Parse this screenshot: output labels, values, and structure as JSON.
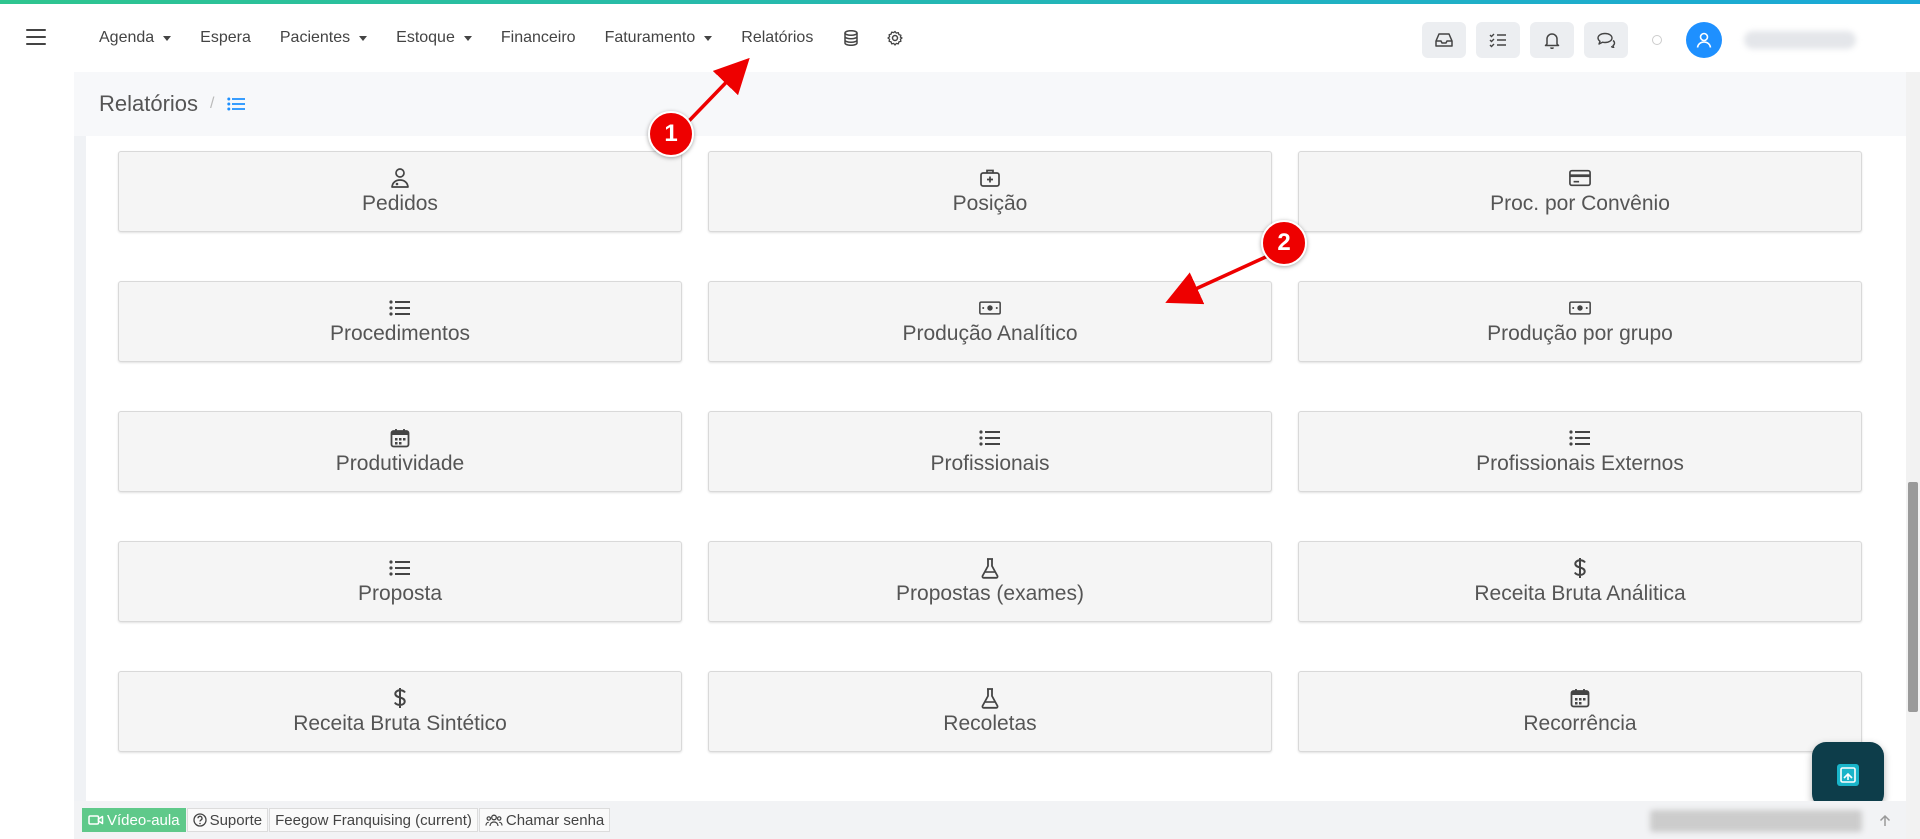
{
  "nav": {
    "items": [
      {
        "label": "Agenda",
        "dropdown": true
      },
      {
        "label": "Espera",
        "dropdown": false
      },
      {
        "label": "Pacientes",
        "dropdown": true
      },
      {
        "label": "Estoque",
        "dropdown": true
      },
      {
        "label": "Financeiro",
        "dropdown": false
      },
      {
        "label": "Faturamento",
        "dropdown": true
      },
      {
        "label": "Relatórios",
        "dropdown": false
      }
    ],
    "icons": [
      "database-icon",
      "gear-icon"
    ],
    "tools": [
      "inbox-icon",
      "checklist-icon",
      "bell-icon",
      "chat-icon"
    ]
  },
  "breadcrumb": {
    "title": "Relatórios",
    "separator": "/"
  },
  "reports": [
    {
      "label": "Pedidos",
      "icon": "doctor-icon"
    },
    {
      "label": "Posição",
      "icon": "medkit-icon"
    },
    {
      "label": "Proc. por Convênio",
      "icon": "credit-card-icon"
    },
    {
      "label": "Procedimentos",
      "icon": "list-icon"
    },
    {
      "label": "Produção Analítico",
      "icon": "money-icon"
    },
    {
      "label": "Produção por grupo",
      "icon": "money-icon"
    },
    {
      "label": "Produtividade",
      "icon": "calendar-icon"
    },
    {
      "label": "Profissionais",
      "icon": "list-icon"
    },
    {
      "label": "Profissionais Externos",
      "icon": "list-icon"
    },
    {
      "label": "Proposta",
      "icon": "list-icon"
    },
    {
      "label": "Propostas (exames)",
      "icon": "flask-icon"
    },
    {
      "label": "Receita Bruta Análitica",
      "icon": "dollar-icon"
    },
    {
      "label": "Receita Bruta Sintético",
      "icon": "dollar-icon"
    },
    {
      "label": "Recoletas",
      "icon": "flask-icon"
    },
    {
      "label": "Recorrência",
      "icon": "calendar-icon"
    }
  ],
  "footer": {
    "video": "Vídeo-aula",
    "support": "Suporte",
    "unit": "Feegow Franquising (current)",
    "call": "Chamar senha"
  },
  "annotations": {
    "badge1": "1",
    "badge2": "2",
    "color": "#e00000"
  },
  "colors": {
    "accent": "#1e90ff",
    "video": "#5fc98a",
    "float": "#0d3d4a"
  }
}
